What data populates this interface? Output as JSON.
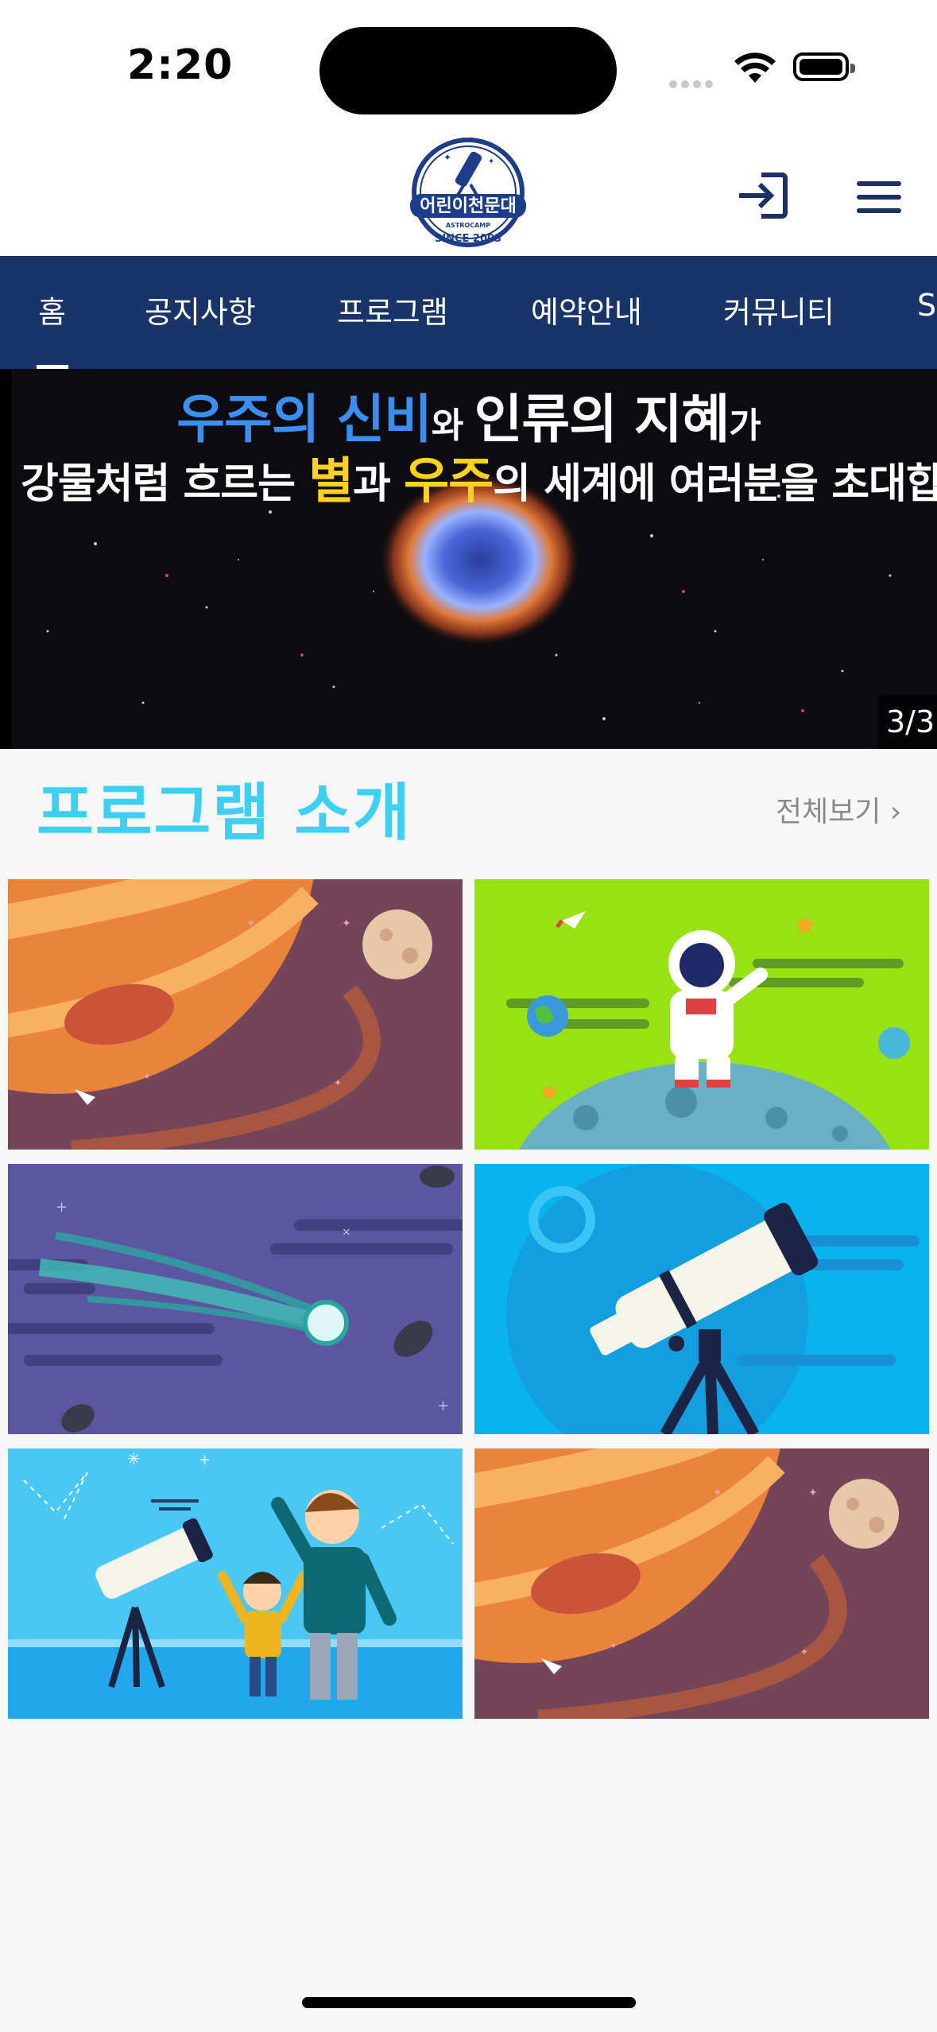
{
  "status_bar": {
    "time": "2:20"
  },
  "header": {
    "logo_text": "어린이천문대",
    "logo_sub": "ASTROCAMP",
    "logo_since": "SINCE 2003"
  },
  "nav": {
    "items": [
      {
        "label": "홈",
        "active": true
      },
      {
        "label": "공지사항"
      },
      {
        "label": "프로그램"
      },
      {
        "label": "예약안내"
      },
      {
        "label": "커뮤니티"
      },
      {
        "label": "S"
      }
    ]
  },
  "banner": {
    "line1_a": "우주의 신비",
    "line1_b": "와 ",
    "line1_c": "인류의 지혜",
    "line1_d": "가",
    "line2_a": "강물처럼 흐르는 ",
    "line2_b": "별",
    "line2_c": "과 ",
    "line2_d": "우주",
    "line2_e": "의 세계에 여러분을 초대합니다.",
    "counter": "3/3"
  },
  "programs": {
    "title": "프로그램 소개",
    "see_all": "전체보기 ›",
    "cards": [
      {
        "name": "planet-saturn"
      },
      {
        "name": "astronaut-moon"
      },
      {
        "name": "comet"
      },
      {
        "name": "telescope-blue"
      },
      {
        "name": "family-telescope"
      },
      {
        "name": "planet-saturn-2"
      }
    ]
  },
  "colors": {
    "nav_bg": "#183468",
    "section_title": "#3dd0f2"
  }
}
